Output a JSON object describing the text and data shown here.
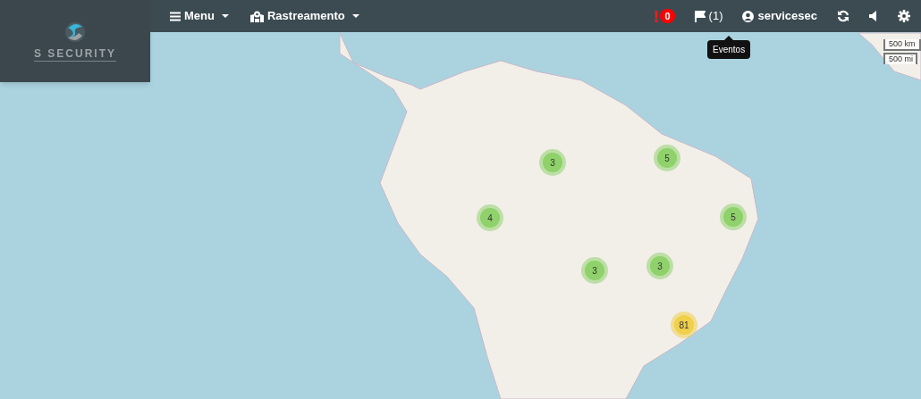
{
  "logo": {
    "text": "S SECURITY"
  },
  "navbar": {
    "menus": [
      {
        "label": "Menu",
        "kind": "menu"
      },
      {
        "label": "Rastreamento",
        "kind": "map"
      }
    ],
    "alerts": {
      "count": "0"
    },
    "events": {
      "label": "(1)",
      "tooltip": "Eventos"
    },
    "user": {
      "name": "servicesec"
    }
  },
  "scale": {
    "metric": "500 km",
    "imperial": "500 mi"
  },
  "clusters": [
    {
      "count": "5",
      "color": "#8fd16a"
    },
    {
      "count": "3",
      "color": "#8fd16a"
    },
    {
      "count": "5",
      "color": "#8fd16a"
    },
    {
      "count": "4",
      "color": "#8fd16a"
    },
    {
      "count": "3",
      "color": "#8fd16a"
    },
    {
      "count": "3",
      "color": "#8fd16a"
    },
    {
      "count": "81",
      "color": "#f0cf4a"
    }
  ]
}
